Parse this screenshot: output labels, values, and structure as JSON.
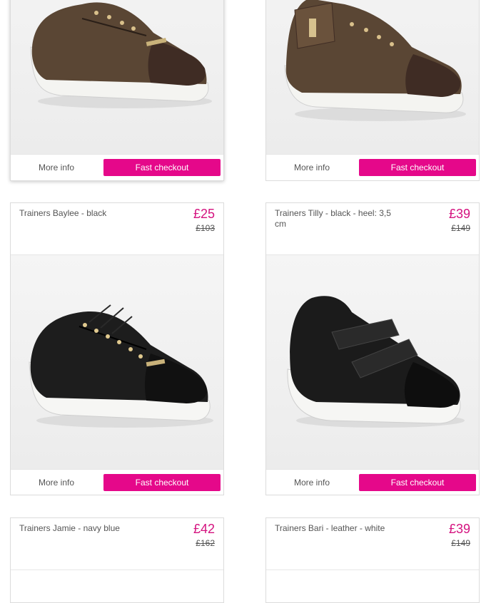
{
  "colors": {
    "accent": "#e5088a",
    "price": "#d4127f",
    "text": "#555555"
  },
  "actions": {
    "more_info": "More info",
    "fast_checkout": "Fast checkout"
  },
  "products": [
    {
      "name": "",
      "price": "",
      "old_price": "",
      "image": "brown-monogram-sneaker-icon"
    },
    {
      "name": "",
      "price": "",
      "old_price": "",
      "image": "brown-monogram-strap-sneaker-icon"
    },
    {
      "name": "Trainers Baylee - black",
      "price": "£25",
      "old_price": "£103",
      "image": "black-lace-up-sneaker-icon"
    },
    {
      "name": "Trainers Tilly - black - heel: 3,5 cm",
      "price": "£39",
      "old_price": "£149",
      "image": "black-strap-sneaker-icon"
    },
    {
      "name": "Trainers Jamie - navy blue",
      "price": "£42",
      "old_price": "£162",
      "image": ""
    },
    {
      "name": "Trainers Bari - leather - white",
      "price": "£39",
      "old_price": "£149",
      "image": ""
    }
  ]
}
